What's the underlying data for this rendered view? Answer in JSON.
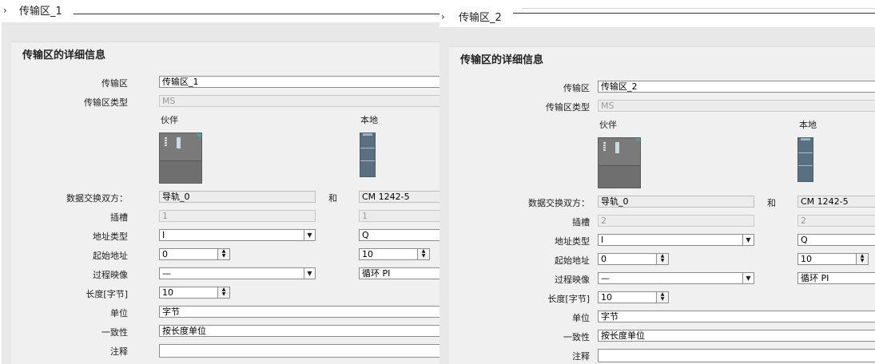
{
  "panel1": {
    "title": "传输区_1",
    "section_title": "传输区的详细信息",
    "labels": {
      "transfer_area": "传输区",
      "type": "传输区类型",
      "exchange": "数据交换双方：",
      "slot": "插槽",
      "addr_type": "地址类型",
      "start_addr": "起始地址",
      "process_image": "过程映像",
      "length": "长度[字节]",
      "unit": "单位",
      "consistency": "一致性",
      "comment": "注释"
    },
    "col_partner": "伙伴",
    "col_local": "本地",
    "and_label": "和",
    "values": {
      "transfer_area": "传输区_1",
      "type": "MS",
      "partner_exchange": "导轨_0",
      "local_exchange": "CM 1242-5",
      "partner_slot": "1",
      "local_slot": "1",
      "partner_addr_type": "I",
      "local_addr_type": "Q",
      "partner_start": "0",
      "local_start": "10",
      "partner_pi": "—",
      "local_pi": "循环 PI",
      "length": "10",
      "unit": "字节",
      "consistency": "按长度单位",
      "comment": ""
    }
  },
  "panel2": {
    "title": "传输区_2",
    "section_title": "传输区的详细信息",
    "labels": {
      "transfer_area": "传输区",
      "type": "传输区类型",
      "exchange": "数据交换双方：",
      "slot": "插槽",
      "addr_type": "地址类型",
      "start_addr": "起始地址",
      "process_image": "过程映像",
      "length": "长度[字节]",
      "unit": "单位",
      "consistency": "一致性",
      "comment": "注释"
    },
    "col_partner": "伙伴",
    "col_local": "本地",
    "and_label": "和",
    "values": {
      "transfer_area": "传输区_2",
      "type": "MS",
      "partner_exchange": "导轨_0",
      "local_exchange": "CM 1242-5",
      "partner_slot": "2",
      "local_slot": "2",
      "partner_addr_type": "I",
      "local_addr_type": "Q",
      "partner_start": "0",
      "local_start": "10",
      "partner_pi": "—",
      "local_pi": "循环 PI",
      "length": "10",
      "unit": "字节",
      "consistency": "按长度单位",
      "comment": ""
    }
  },
  "icons": {
    "expand": "chevron-right-icon",
    "dropdown": "dropdown-arrow-icon",
    "spinner": "spinner-arrows-icon"
  }
}
